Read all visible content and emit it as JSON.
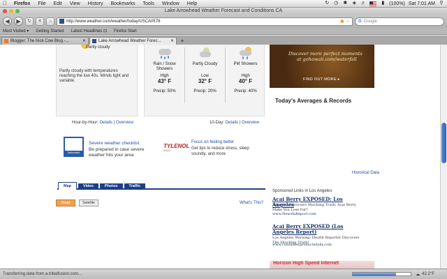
{
  "menubar": {
    "apple_icon": "apple-icon",
    "app_name": "Firefox",
    "menus": [
      "File",
      "Edit",
      "View",
      "History",
      "Bookmarks",
      "Tools",
      "Window",
      "Help"
    ],
    "battery": "(100%)",
    "clock": "Sat 7:01 AM"
  },
  "window": {
    "title": "Lake Arrowhead Weather Forecast and Conditions CA"
  },
  "toolbar": {
    "url": "http://www.weather.com/weather/today/USCA0578",
    "search_placeholder": "Google",
    "search_engine_label": "G"
  },
  "bookmarks": [
    "Most Visited ▾",
    "Getting Started",
    "Latest Headlines ⊡",
    "Firefox Start"
  ],
  "tabs": [
    {
      "label": "Blogger: The Nick Cow Blog -...",
      "active": false
    },
    {
      "label": "Lake Arrowhead Weather Forec...",
      "active": true
    }
  ],
  "current": {
    "title": "Partly cloudy",
    "description": "Partly cloudy with temperatures reaching the low 40s. Winds light and variable."
  },
  "forecast": [
    {
      "label": "Rain / Snow Showers",
      "hl": "High",
      "temp": "43° F",
      "precip": "Precip: 50%"
    },
    {
      "label": "Partly Cloudy",
      "hl": "Low",
      "temp": "32° F",
      "precip": "Precip: 20%"
    },
    {
      "label": "PM Showers",
      "hl": "High",
      "temp": "40° F",
      "precip": "Precip: 40%"
    }
  ],
  "links": {
    "hour_prefix": "Hour-by-Hour:",
    "ten_day_prefix": "10-Day:",
    "details": "Details",
    "sep": "|",
    "overview": "Overview"
  },
  "ad": {
    "line1": "Discover more perfect moments",
    "line2": "at gohawaii.com/waterfall",
    "button": "FIND OUT MORE ▸"
  },
  "averages_title": "Today's Averages & Records",
  "checklist": {
    "icon_caption": "Nationwide",
    "title": "Severe weather checklist",
    "desc": "Be prepared in case severe weather hits your area"
  },
  "tylenol": {
    "brand": "TYLENOL",
    "sub": "COLD",
    "title": "Focus on feeling better",
    "desc": "Get tips to reduce stress, sleep soundly, and more"
  },
  "historical_link": "Historical Data",
  "map_tabs": [
    "Map",
    "Video",
    "Photos",
    "Traffic"
  ],
  "map_buttons": {
    "road": "Road",
    "satellite": "Satellite"
  },
  "whats_this": "What's This?",
  "sponsored": {
    "title": "Sponsored Links in Los Angeles",
    "items": [
      {
        "head": "Acai Berry EXPOSED: Los Angeles",
        "desc": "Reporter Discovers Shocking Truth: Acai Berry Make You Lose Fat?",
        "url": "www.NewsInReport.com"
      },
      {
        "head": "Acai Berry EXPOSED (Los Angeles Report)",
        "desc": "Los Angeles Warning: Health Reporter Discovers The Shocking Truth!",
        "url": "www.consumerproductsdaily.com"
      }
    ]
  },
  "bottom_ad": "Horizon High Speed Internet",
  "status": {
    "text": "Transferring data from a.tribalfusion.com...",
    "temp": "42.2°F",
    "progress": 0.74
  },
  "colors": {
    "link": "#1d4fa8",
    "map_tab": "#1d3f8a",
    "road_button": "#f0a050"
  }
}
